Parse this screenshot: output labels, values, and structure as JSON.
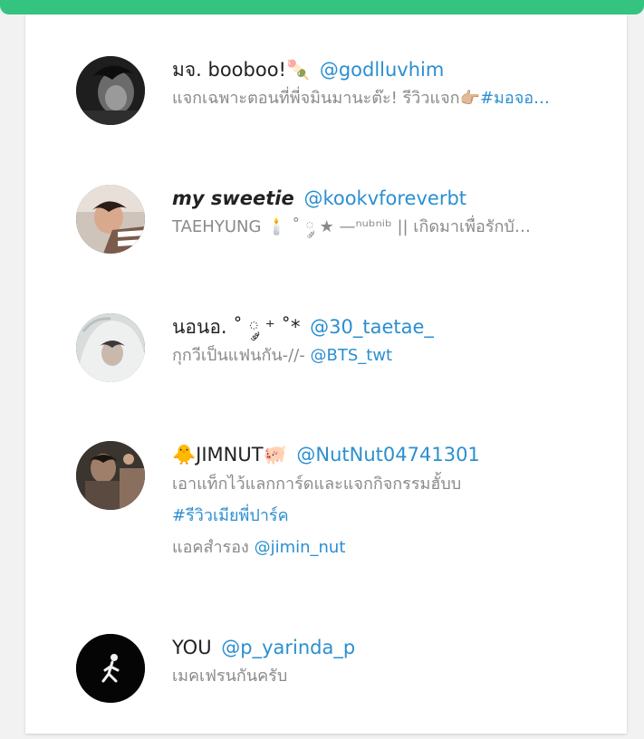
{
  "colors": {
    "accent_bar": "#35c47f",
    "link": "#2b8fd0",
    "name": "#222222",
    "bio": "#8a8a8a"
  },
  "users": [
    {
      "display_name": "มจ. booboo!🍡",
      "handle": "@godlluvhim",
      "bio_text": "แจกเฉพาะตอนที่พี่จมินมานะต๊ะ! รีวิวแจก👉🏼",
      "bio_tag": "#มอจอ…"
    },
    {
      "display_name": "my sweetie",
      "handle": "@kookvforeverbt",
      "bio_text": "TAEHYUNG 🕯️ ˚ ༘ ★ —ⁿᵘᵇⁿⁱᵇ || เกิดมาเพื่อรักบั…"
    },
    {
      "display_name": "นอนอ. ˚ ༘ ⁺ ˚*",
      "handle": "@30_taetae_",
      "bio_text": "กุกวีเป็นแฟนกัน-//-",
      "bio_mention": "@BTS_twt"
    },
    {
      "display_name": "🐥JIMNUT🐖",
      "handle": "@NutNut04741301",
      "bio_line1": "เอาแท็กไว้แลกการ์ดและแจกกิจกรรมฮั้บบ",
      "bio_line2_tag": "#รีวิวเมียพี่ปาร์ค",
      "bio_line3_text": "แอคสำรอง",
      "bio_line3_mention": "@jimin_nut"
    },
    {
      "display_name": "YOU",
      "handle": "@p_yarinda_p",
      "bio_text": "เมคเฟรนกันครับ"
    }
  ]
}
